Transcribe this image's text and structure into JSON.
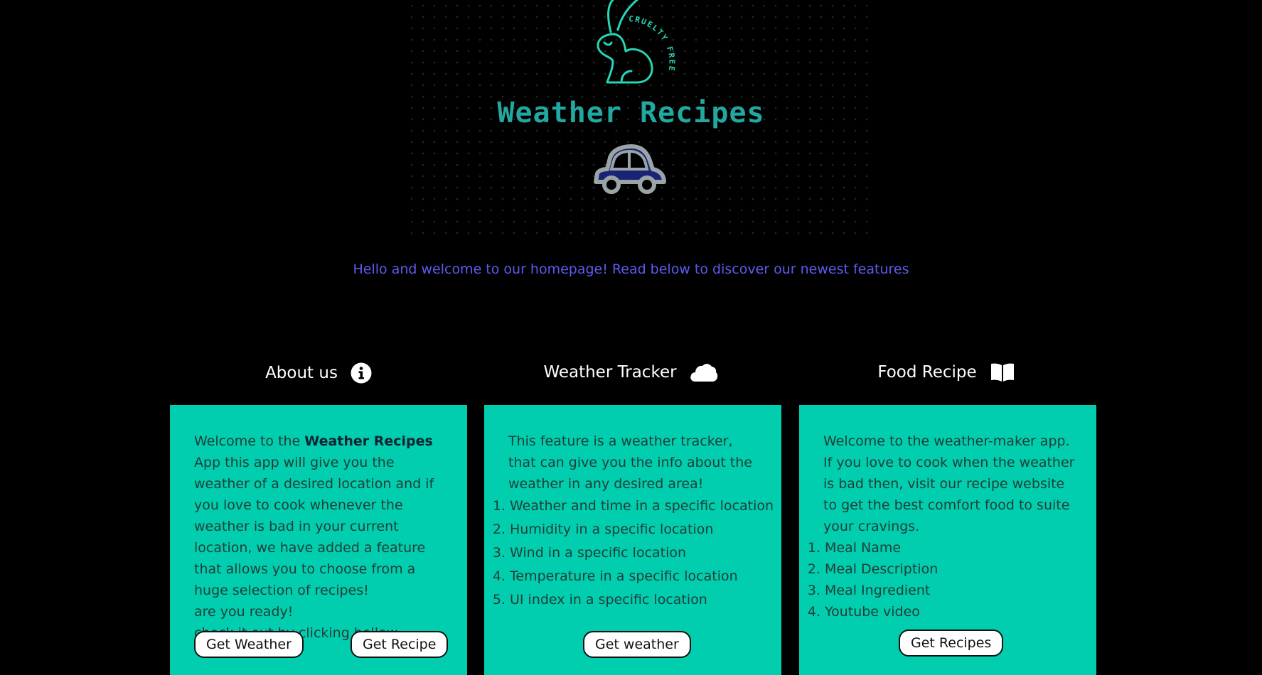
{
  "header": {
    "logo_text": "CRUELTY FREE",
    "title": "Weather Recipes",
    "welcome": "Hello and welcome to our homepage! Read below to discover our newest features"
  },
  "about": {
    "heading": "About us",
    "icon": "info-circle-icon",
    "text_before": "Welcome to the ",
    "text_bold": "Weather Recipes",
    "text_after": " App this app will give you the weather of a desired location and if you love to cook whenever the weather is bad in your current location, we have added a feature that allows you to choose from a huge selection of recipes!",
    "line_ready": "are you ready!",
    "line_check": "check it out by clicking bellow",
    "button_weather": "Get Weather",
    "button_recipe": "Get Recipe"
  },
  "weather": {
    "heading": "Weather Tracker",
    "icon": "cloud-icon",
    "intro": "This feature is a weather tracker, that can give you the info about the weather in any desired area!",
    "items": [
      "Weather and time in a specific location",
      "Humidity in a specific location",
      "Wind in a specific location",
      "Temperature in a specific location",
      "UI index in a specific location"
    ],
    "button": "Get weather"
  },
  "food": {
    "heading": "Food Recipe",
    "icon": "open-book-icon",
    "intro": "Welcome to the weather-maker app. If you love to cook when the weather is bad then, visit our recipe website to get the best comfort food to suite your cravings.",
    "items": [
      "Meal Name",
      "Meal Description",
      "Meal Ingredient",
      "Youtube video"
    ],
    "button": "Get Recipes"
  },
  "colors": {
    "background": "#000000",
    "card": "#00ceae",
    "title": "#22a8a0",
    "welcome": "#5b5cf0"
  }
}
